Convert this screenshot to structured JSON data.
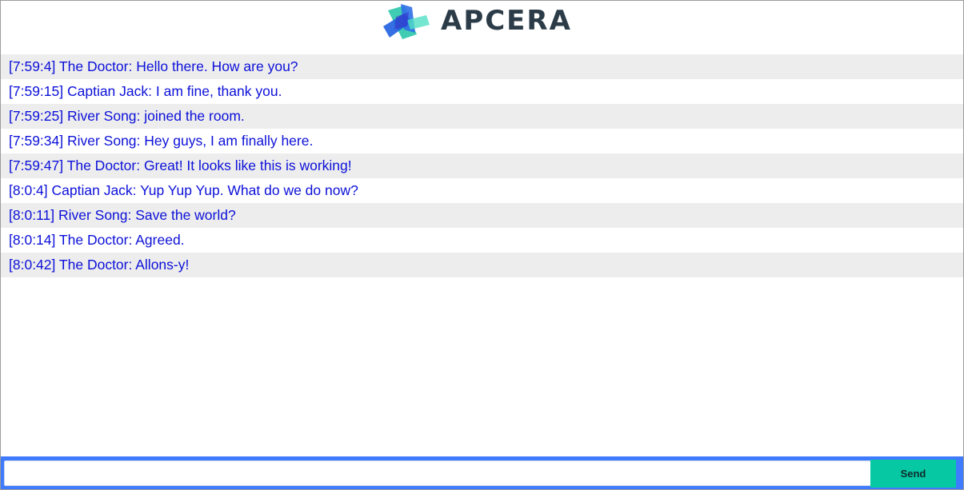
{
  "header": {
    "brand_text": "APCERA",
    "logo_icon": "apcera-logo-icon"
  },
  "colors": {
    "message_text": "#0c10d8",
    "stripe": "#ededed",
    "composer_border": "#3f7bff",
    "send_button": "#06c9a4",
    "brand_text": "#2b3c48"
  },
  "messages": [
    {
      "text": "[7:59:4] The Doctor: Hello there. How are you?"
    },
    {
      "text": "[7:59:15] Captian Jack: I am fine, thank you."
    },
    {
      "text": "[7:59:25] River Song: joined the room."
    },
    {
      "text": "[7:59:34] River Song: Hey guys, I am finally here."
    },
    {
      "text": "[7:59:47] The Doctor: Great! It looks like this is working!"
    },
    {
      "text": "[8:0:4] Captian Jack: Yup Yup Yup. What do we do now?"
    },
    {
      "text": "[8:0:11] River Song: Save the world?"
    },
    {
      "text": "[8:0:14] The Doctor: Agreed."
    },
    {
      "text": "[8:0:42] The Doctor: Allons-y!"
    }
  ],
  "composer": {
    "input_value": "",
    "send_label": "Send"
  }
}
